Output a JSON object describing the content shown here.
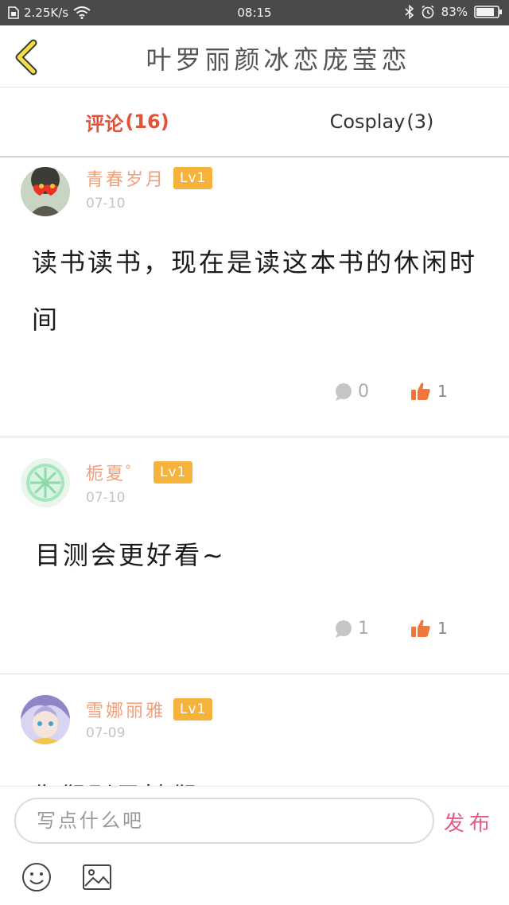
{
  "status_bar": {
    "net_speed": "2.25K/s",
    "time": "08:15",
    "battery": "83%"
  },
  "header": {
    "title": "叶罗丽颜冰恋庞莹恋"
  },
  "tabs": [
    {
      "label": "评论",
      "count": "(16)"
    },
    {
      "label": "Cosplay",
      "count": "(3)"
    }
  ],
  "comments": [
    {
      "username": "青春岁月",
      "level": "Lv1",
      "date": "07-10",
      "content": "读书读书，现在是读这本书的休闲时间",
      "replies": "0",
      "likes": "1"
    },
    {
      "username": "栀夏゜",
      "level": "Lv1",
      "date": "07-10",
      "content": "目测会更好看~",
      "replies": "1",
      "likes": "1"
    },
    {
      "username": "雪娜丽雅",
      "level": "Lv1",
      "date": "07-09",
      "content": "你们别黑她们了！"
    }
  ],
  "input_bar": {
    "placeholder": "写点什么吧",
    "publish_label": "发布"
  }
}
